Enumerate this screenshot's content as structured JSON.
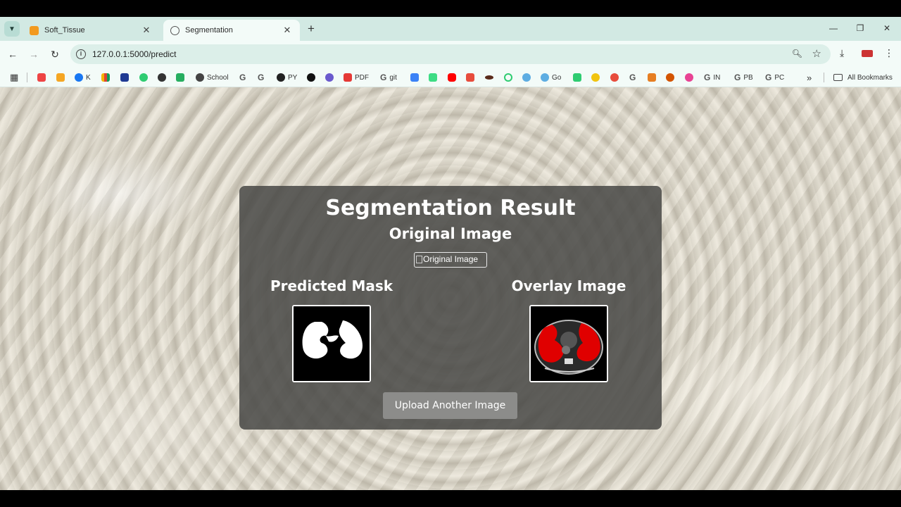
{
  "tabs": [
    {
      "label": "Soft_Tissue",
      "active": false
    },
    {
      "label": "Segmentation",
      "active": true
    }
  ],
  "address_bar": {
    "url": "127.0.0.1:5000/predict"
  },
  "bookmarks": [
    {
      "label": "K",
      "icon": "facebook-icon"
    },
    {
      "label": "School",
      "icon": "globe-icon"
    },
    {
      "label": "PY",
      "icon": "github-icon"
    },
    {
      "label": "PDF",
      "icon": "pdf-icon"
    },
    {
      "label": "git",
      "icon": "google-icon"
    },
    {
      "label": "Go",
      "icon": "heart-icon"
    },
    {
      "label": "IN",
      "icon": "google-icon"
    },
    {
      "label": "PB",
      "icon": "google-icon"
    },
    {
      "label": "PC",
      "icon": "google-icon"
    }
  ],
  "all_bookmarks_label": "All Bookmarks",
  "more_bookmarks_label": "»",
  "card": {
    "title": "Segmentation Result",
    "original_heading": "Original Image",
    "original_alt": "Original Image",
    "mask_heading": "Predicted Mask",
    "overlay_heading": "Overlay Image",
    "upload_button": "Upload Another Image"
  },
  "colors": {
    "tab_strip": "#d2e9e3",
    "toolbar": "#f3fbf8",
    "card_bg": "#484846",
    "overlay_red": "#e00000"
  }
}
